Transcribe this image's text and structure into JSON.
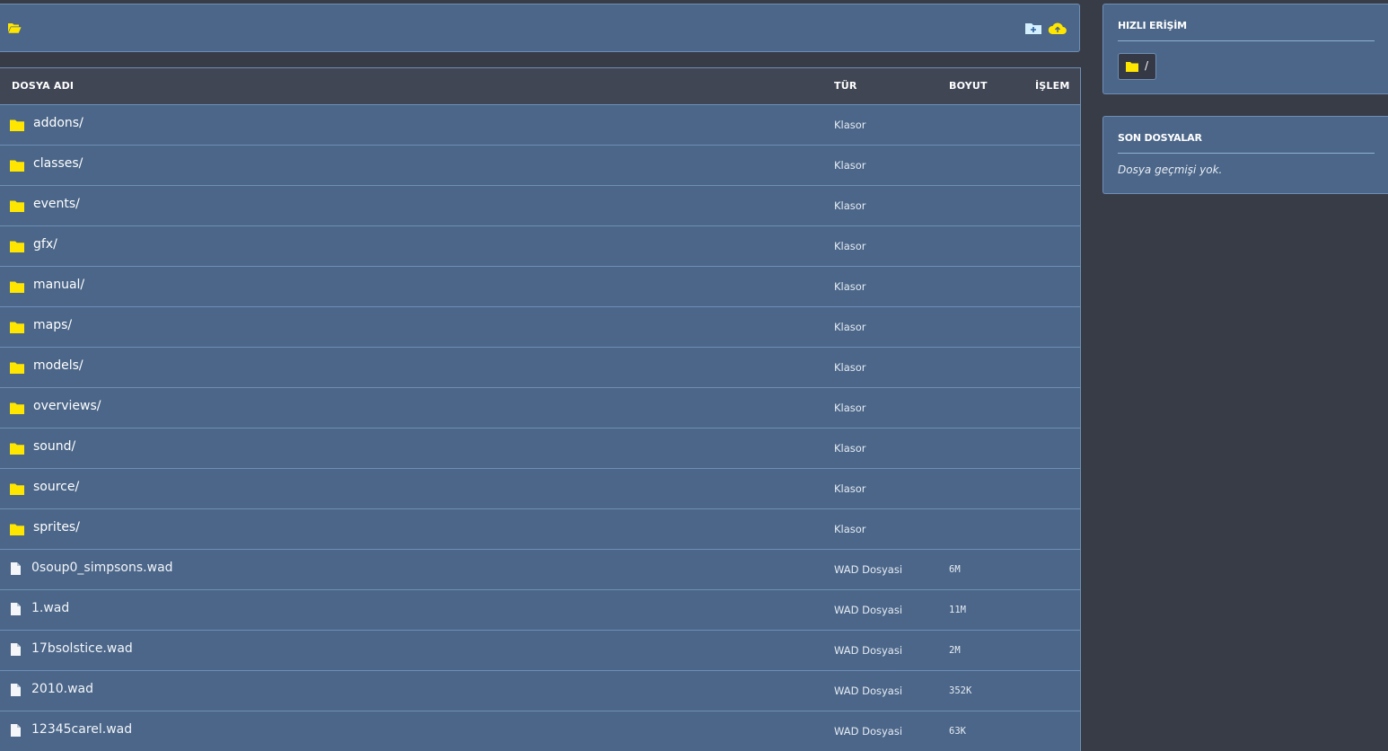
{
  "toolbar": {
    "current_dir_icon": "folder-open-icon",
    "new_folder_icon": "folder-plus-icon",
    "upload_icon": "cloud-upload-icon"
  },
  "table": {
    "headers": {
      "name": "DOSYA ADI",
      "type": "TÜR",
      "size": "BOYUT",
      "action": "İŞLEM"
    },
    "rows": [
      {
        "kind": "folder",
        "name": "addons/",
        "type": "Klasor",
        "size": ""
      },
      {
        "kind": "folder",
        "name": "classes/",
        "type": "Klasor",
        "size": ""
      },
      {
        "kind": "folder",
        "name": "events/",
        "type": "Klasor",
        "size": ""
      },
      {
        "kind": "folder",
        "name": "gfx/",
        "type": "Klasor",
        "size": ""
      },
      {
        "kind": "folder",
        "name": "manual/",
        "type": "Klasor",
        "size": ""
      },
      {
        "kind": "folder",
        "name": "maps/",
        "type": "Klasor",
        "size": ""
      },
      {
        "kind": "folder",
        "name": "models/",
        "type": "Klasor",
        "size": ""
      },
      {
        "kind": "folder",
        "name": "overviews/",
        "type": "Klasor",
        "size": ""
      },
      {
        "kind": "folder",
        "name": "sound/",
        "type": "Klasor",
        "size": ""
      },
      {
        "kind": "folder",
        "name": "source/",
        "type": "Klasor",
        "size": ""
      },
      {
        "kind": "folder",
        "name": "sprites/",
        "type": "Klasor",
        "size": ""
      },
      {
        "kind": "file",
        "name": "0soup0_simpsons.wad",
        "type": "WAD Dosyasi",
        "size": "6M"
      },
      {
        "kind": "file",
        "name": "1.wad",
        "type": "WAD Dosyasi",
        "size": "11M"
      },
      {
        "kind": "file",
        "name": "17bsolstice.wad",
        "type": "WAD Dosyasi",
        "size": "2M"
      },
      {
        "kind": "file",
        "name": "2010.wad",
        "type": "WAD Dosyasi",
        "size": "352K"
      },
      {
        "kind": "file",
        "name": "12345carel.wad",
        "type": "WAD Dosyasi",
        "size": "63K"
      }
    ]
  },
  "sidebar": {
    "quick_access": {
      "title": "HIZLI ERİŞİM",
      "items": [
        {
          "label": "/",
          "icon": "folder-icon"
        }
      ]
    },
    "recent_files": {
      "title": "SON DOSYALAR",
      "empty_text": "Dosya geçmişi yok."
    }
  },
  "colors": {
    "panel": "#4b6688",
    "header": "#414655",
    "background": "#383c47",
    "border": "#6f8fb6",
    "folder_yellow": "#ffe600"
  }
}
